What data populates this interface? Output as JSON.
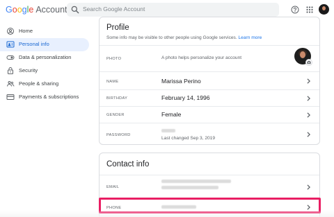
{
  "header": {
    "logo_word": "Google",
    "logo_suffix": "Account",
    "search_placeholder": "Search Google Account",
    "icons": [
      "search-icon",
      "help-icon",
      "apps-icon",
      "account-avatar"
    ]
  },
  "sidebar": {
    "items": [
      {
        "label": "Home",
        "icon": "home-icon",
        "active": false
      },
      {
        "label": "Personal info",
        "icon": "person-card-icon",
        "active": true
      },
      {
        "label": "Data & personalization",
        "icon": "toggle-icon",
        "active": false
      },
      {
        "label": "Security",
        "icon": "lock-icon",
        "active": false
      },
      {
        "label": "People & sharing",
        "icon": "people-icon",
        "active": false
      },
      {
        "label": "Payments & subscriptions",
        "icon": "credit-card-icon",
        "active": false
      }
    ]
  },
  "profile": {
    "title": "Profile",
    "subtitle": "Some info may be visible to other people using Google services.",
    "learn_more": "Learn more",
    "photo_label": "PHOTO",
    "photo_text": "A photo helps personalize your account",
    "name_label": "NAME",
    "name_value": "Marissa Perino",
    "birthday_label": "BIRTHDAY",
    "birthday_value": "February 14, 1996",
    "gender_label": "GENDER",
    "gender_value": "Female",
    "password_label": "PASSWORD",
    "password_changed": "Last changed Sep 3, 2019"
  },
  "contact": {
    "title": "Contact info",
    "email_label": "EMAIL",
    "phone_label": "PHONE"
  },
  "colors": {
    "accent_blue": "#1a73e8",
    "active_nav_bg": "#e8f0fe",
    "highlight": "#e91e63"
  }
}
